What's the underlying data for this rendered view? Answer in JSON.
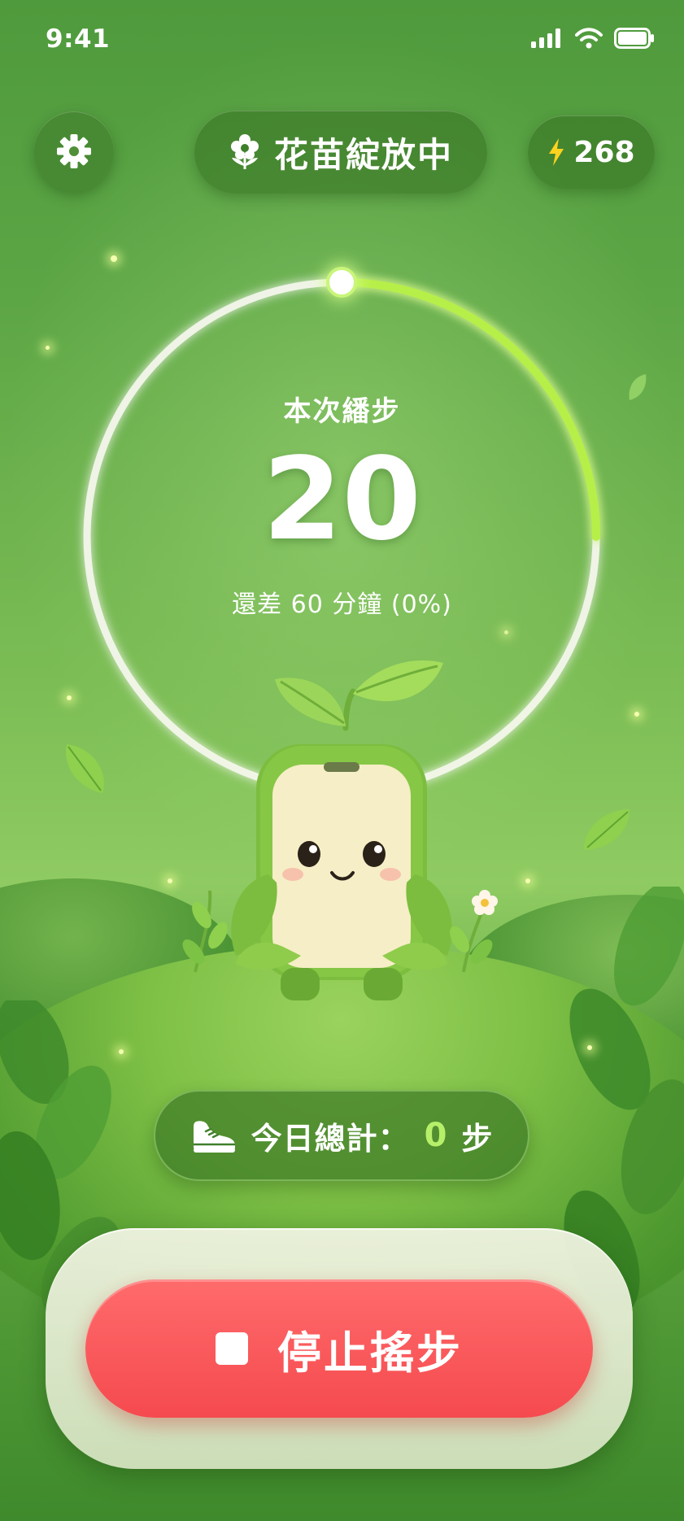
{
  "status_bar": {
    "time": "9:41"
  },
  "header": {
    "stage_label": "花苗綻放中",
    "energy_value": "268"
  },
  "session": {
    "label": "本次繙步",
    "steps": "20",
    "remaining": "還差 60 分鐘 (0%)",
    "progress_fraction": 0.25
  },
  "today": {
    "label": "今日總計：",
    "value": "0",
    "unit": "步"
  },
  "action": {
    "stop_label": "停止搖步"
  },
  "colors": {
    "accent_green": "#b6f06a",
    "stop_red": "#f54a4f",
    "energy_bolt": "#ffd21f"
  },
  "icons": [
    "settings-icon",
    "flower-icon",
    "bolt-icon",
    "shoe-icon",
    "stop-icon",
    "signal-icon",
    "wifi-icon",
    "battery-icon"
  ]
}
